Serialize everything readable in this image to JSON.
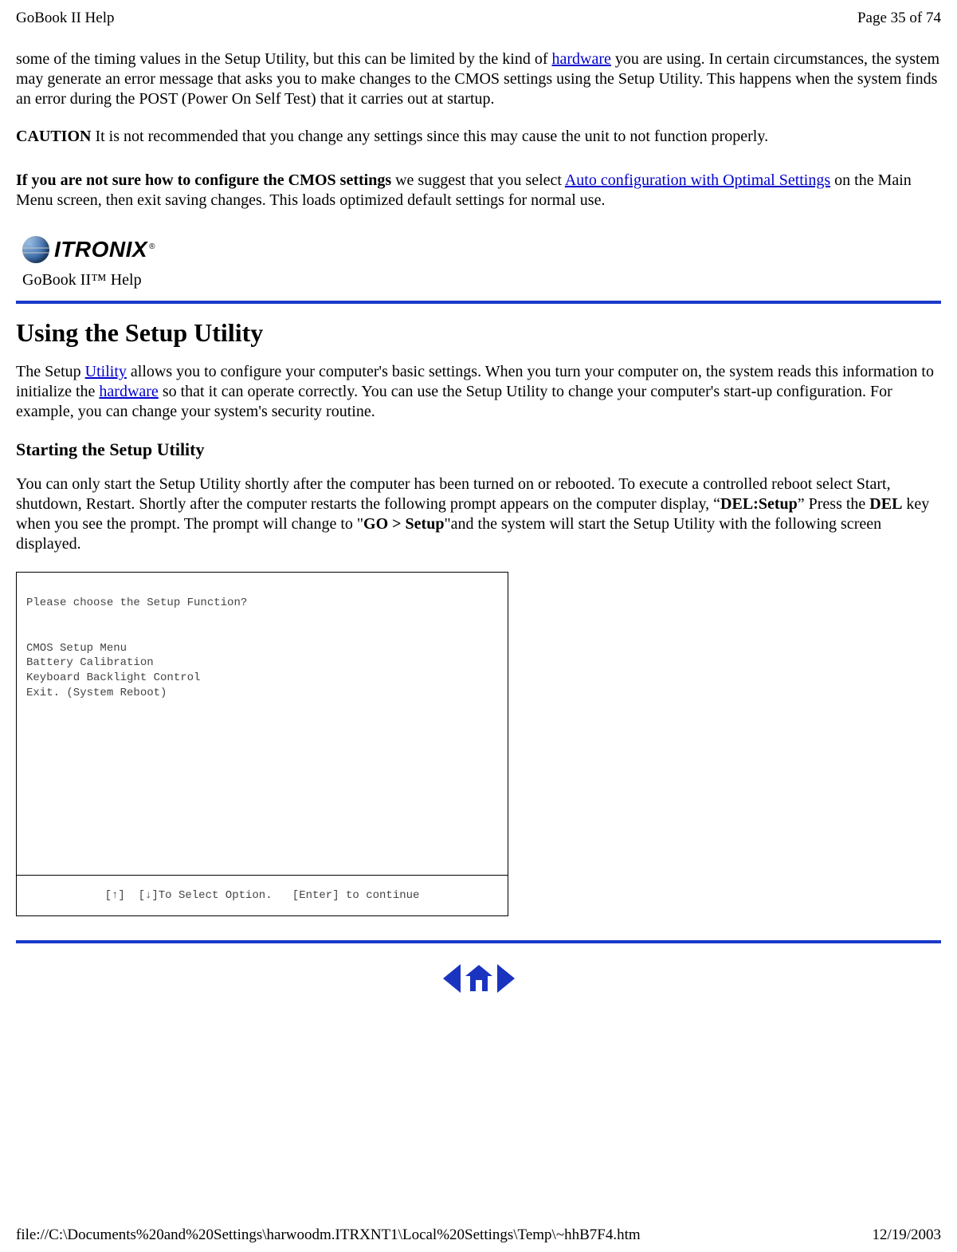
{
  "header": {
    "title": "GoBook II Help",
    "page_label": "Page 35 of 74"
  },
  "intro": {
    "p1_a": "some of the timing values in the Setup Utility, but this can be limited by the kind of ",
    "p1_link": "hardware",
    "p1_b": " you are using. In certain circumstances, the system may generate an error message that asks you to make changes to the CMOS settings using the Setup Utility. This happens when the system finds an error during the POST (Power On Self Test) that it carries out at startup.",
    "caution_label": "CAUTION",
    "caution_text": "  It is not recommended that you change any settings since this may cause the unit to not function properly.",
    "p3_bold": "If you are not sure how to configure the CMOS settings",
    "p3_a": " we suggest that you select ",
    "p3_link": "Auto configuration with Optimal Settings",
    "p3_b": " on the Main Menu screen, then exit saving changes.  This loads optimized default settings for normal use."
  },
  "brand": {
    "name": "ITRONIX",
    "caption": "GoBook II™ Help"
  },
  "section": {
    "title": "Using the Setup Utility",
    "p1_a": "The Setup ",
    "p1_link1": "Utility",
    "p1_b": " allows you to configure your computer's basic settings. When you turn your computer on, the system reads this information to initialize the ",
    "p1_link2": "hardware",
    "p1_c": " so that it can operate correctly. You can use the Setup Utility to change your computer's start-up configuration. For example, you can change your system's security routine.",
    "sub_title": "Starting the Setup Utility",
    "p2_a": "You can only start the Setup Utility shortly after the computer has been turned on or rebooted. To execute a controlled reboot select Start, shutdown, Restart.  Shortly after the computer restarts the following prompt appears on the computer display, “",
    "p2_bold1": "DEL:Setup",
    "p2_b": "”  Press the ",
    "p2_bold2": "DEL",
    "p2_c": " key when you see the  prompt.  The prompt will change to \"",
    "p2_bold3": "GO > Setup",
    "p2_d": "\"and the system will start the Setup Utility with the following screen displayed."
  },
  "setup_screen": {
    "prompt": "Please choose the Setup Function?",
    "menu": [
      "CMOS Setup Menu",
      "Battery Calibration",
      "Keyboard Backlight Control",
      "Exit. (System Reboot)"
    ],
    "footer": "[↑]  [↓]To Select Option.   [Enter] to continue"
  },
  "footer": {
    "path": "file://C:\\Documents%20and%20Settings\\harwoodm.ITRXNT1\\Local%20Settings\\Temp\\~hhB7F4.htm",
    "date": "12/19/2003"
  }
}
